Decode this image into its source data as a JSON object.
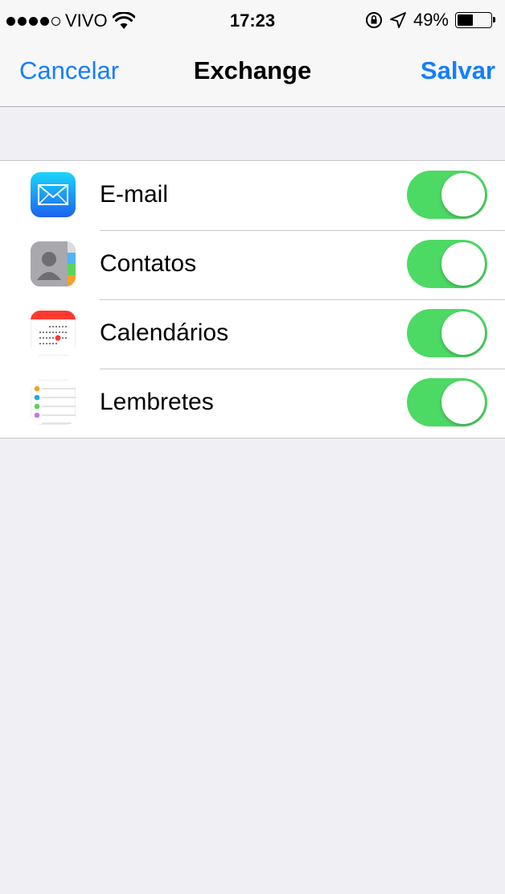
{
  "status_bar": {
    "carrier": "VIVO",
    "signal_bars_filled": 4,
    "signal_bars_total": 5,
    "time": "17:23",
    "battery_percent_label": "49%",
    "battery_level": 0.49
  },
  "nav": {
    "cancel_label": "Cancelar",
    "title": "Exchange",
    "save_label": "Salvar"
  },
  "colors": {
    "accent": "#157efb",
    "switch_on": "#4cd964",
    "background": "#efeff4"
  },
  "services": [
    {
      "label": "E-mail",
      "icon": "mail-icon",
      "enabled": true
    },
    {
      "label": "Contatos",
      "icon": "contacts-icon",
      "enabled": true
    },
    {
      "label": "Calendários",
      "icon": "calendar-icon",
      "enabled": true
    },
    {
      "label": "Lembretes",
      "icon": "reminders-icon",
      "enabled": true
    }
  ]
}
